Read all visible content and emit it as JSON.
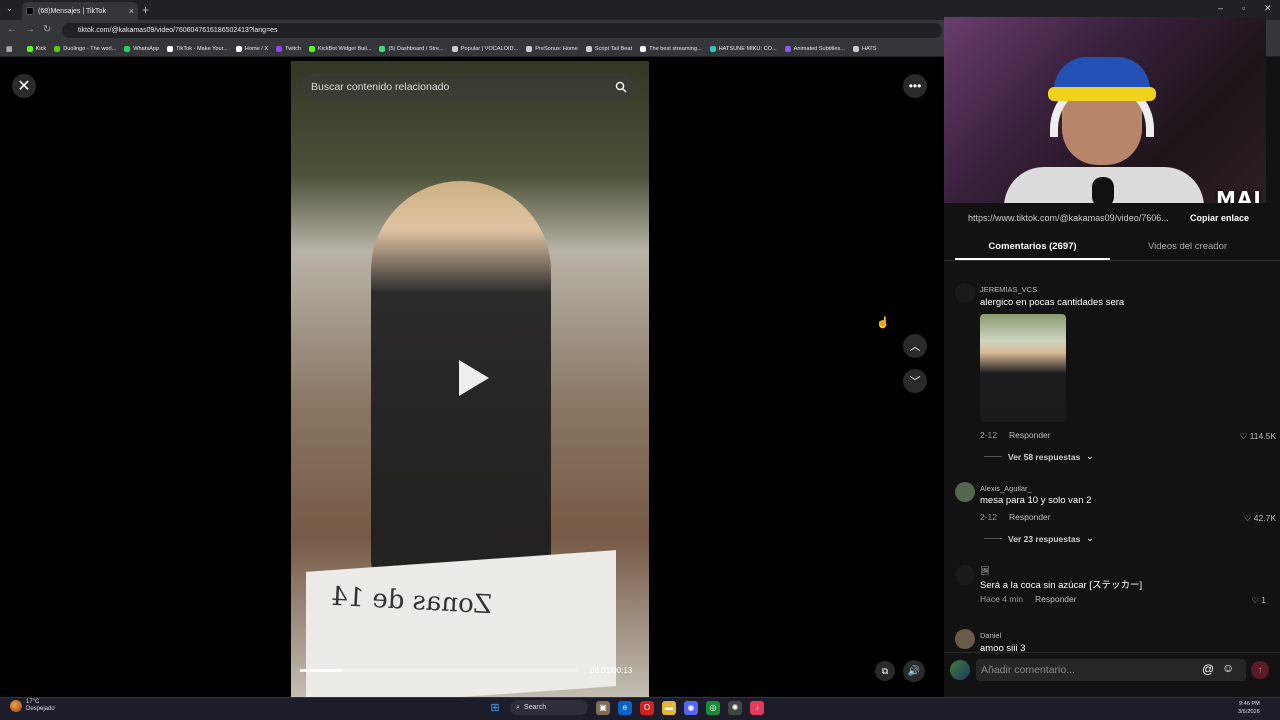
{
  "browser": {
    "tab_title": "(68)Mensajes | TikTok",
    "tab_close": "×",
    "new_tab": "+",
    "url": "tiktok.com/@kakamas09/video/7606047616186502413?lang=es",
    "bookmarks": [
      {
        "label": "Kick",
        "color": "#53fc18"
      },
      {
        "label": "Duolingo - The worl...",
        "color": "#58cc02"
      },
      {
        "label": "WhatsApp",
        "color": "#25d366"
      },
      {
        "label": "TikTok - Make Your...",
        "color": "#ffffff"
      },
      {
        "label": "Home / X",
        "color": "#ffffff"
      },
      {
        "label": "Twitch",
        "color": "#9146ff"
      },
      {
        "label": "KickBot Widget Buil...",
        "color": "#53fc18"
      },
      {
        "label": "(5) Dashboard / Stre...",
        "color": "#3ddc84"
      },
      {
        "label": "Popular | VOCALOID...",
        "color": "#cccccc"
      },
      {
        "label": "PreSonus: Home",
        "color": "#cccccc"
      },
      {
        "label": "Script Tail Beat",
        "color": "#cccccc"
      },
      {
        "label": "The best streaming...",
        "color": "#ffffff"
      },
      {
        "label": "HATSUNE MIKU: CO...",
        "color": "#39c5bb"
      },
      {
        "label": "Animated Subtitles...",
        "color": "#8a5cf6"
      },
      {
        "label": "HATS",
        "color": "#cccccc"
      }
    ]
  },
  "video": {
    "search_placeholder": "Buscar contenido relacionado",
    "sign_text": "Zonas de 14",
    "time": "00:01/00:13",
    "progress": 0.15
  },
  "webcam": {
    "logo": "MAI"
  },
  "panel": {
    "link": "https://www.tiktok.com/@kakamas09/video/7606...",
    "copy_label": "Copiar enlace",
    "tab_comments": "Comentarios (2697)",
    "tab_creator": "Videos del creador",
    "comments": [
      {
        "user": "JEREMIAS_VCS",
        "text": "alergico en pocas cantidades sera",
        "date": "2-12",
        "reply": "Responder",
        "likes": "114.5K",
        "more": "Ver 58 respuestas"
      },
      {
        "user": "Alexis_Aguilar_",
        "text": "mesa para 10 y solo van 2",
        "date": "2-12",
        "reply": "Responder",
        "likes": "42.7K",
        "more": "Ver 23 respuestas"
      },
      {
        "user": "🖼",
        "text": "Será a la coca sin azúcar [ステッカー]",
        "date": "Hace 4 min",
        "reply": "Responder",
        "likes": "1"
      },
      {
        "user": "Daniel",
        "text": "amoo siii 3"
      }
    ],
    "input_placeholder": "Añadir comentario..."
  },
  "taskbar": {
    "temp": "17°C",
    "weather": "Despejado",
    "search": "Search",
    "time": "9:46 PM",
    "date": "3/6/2026"
  }
}
